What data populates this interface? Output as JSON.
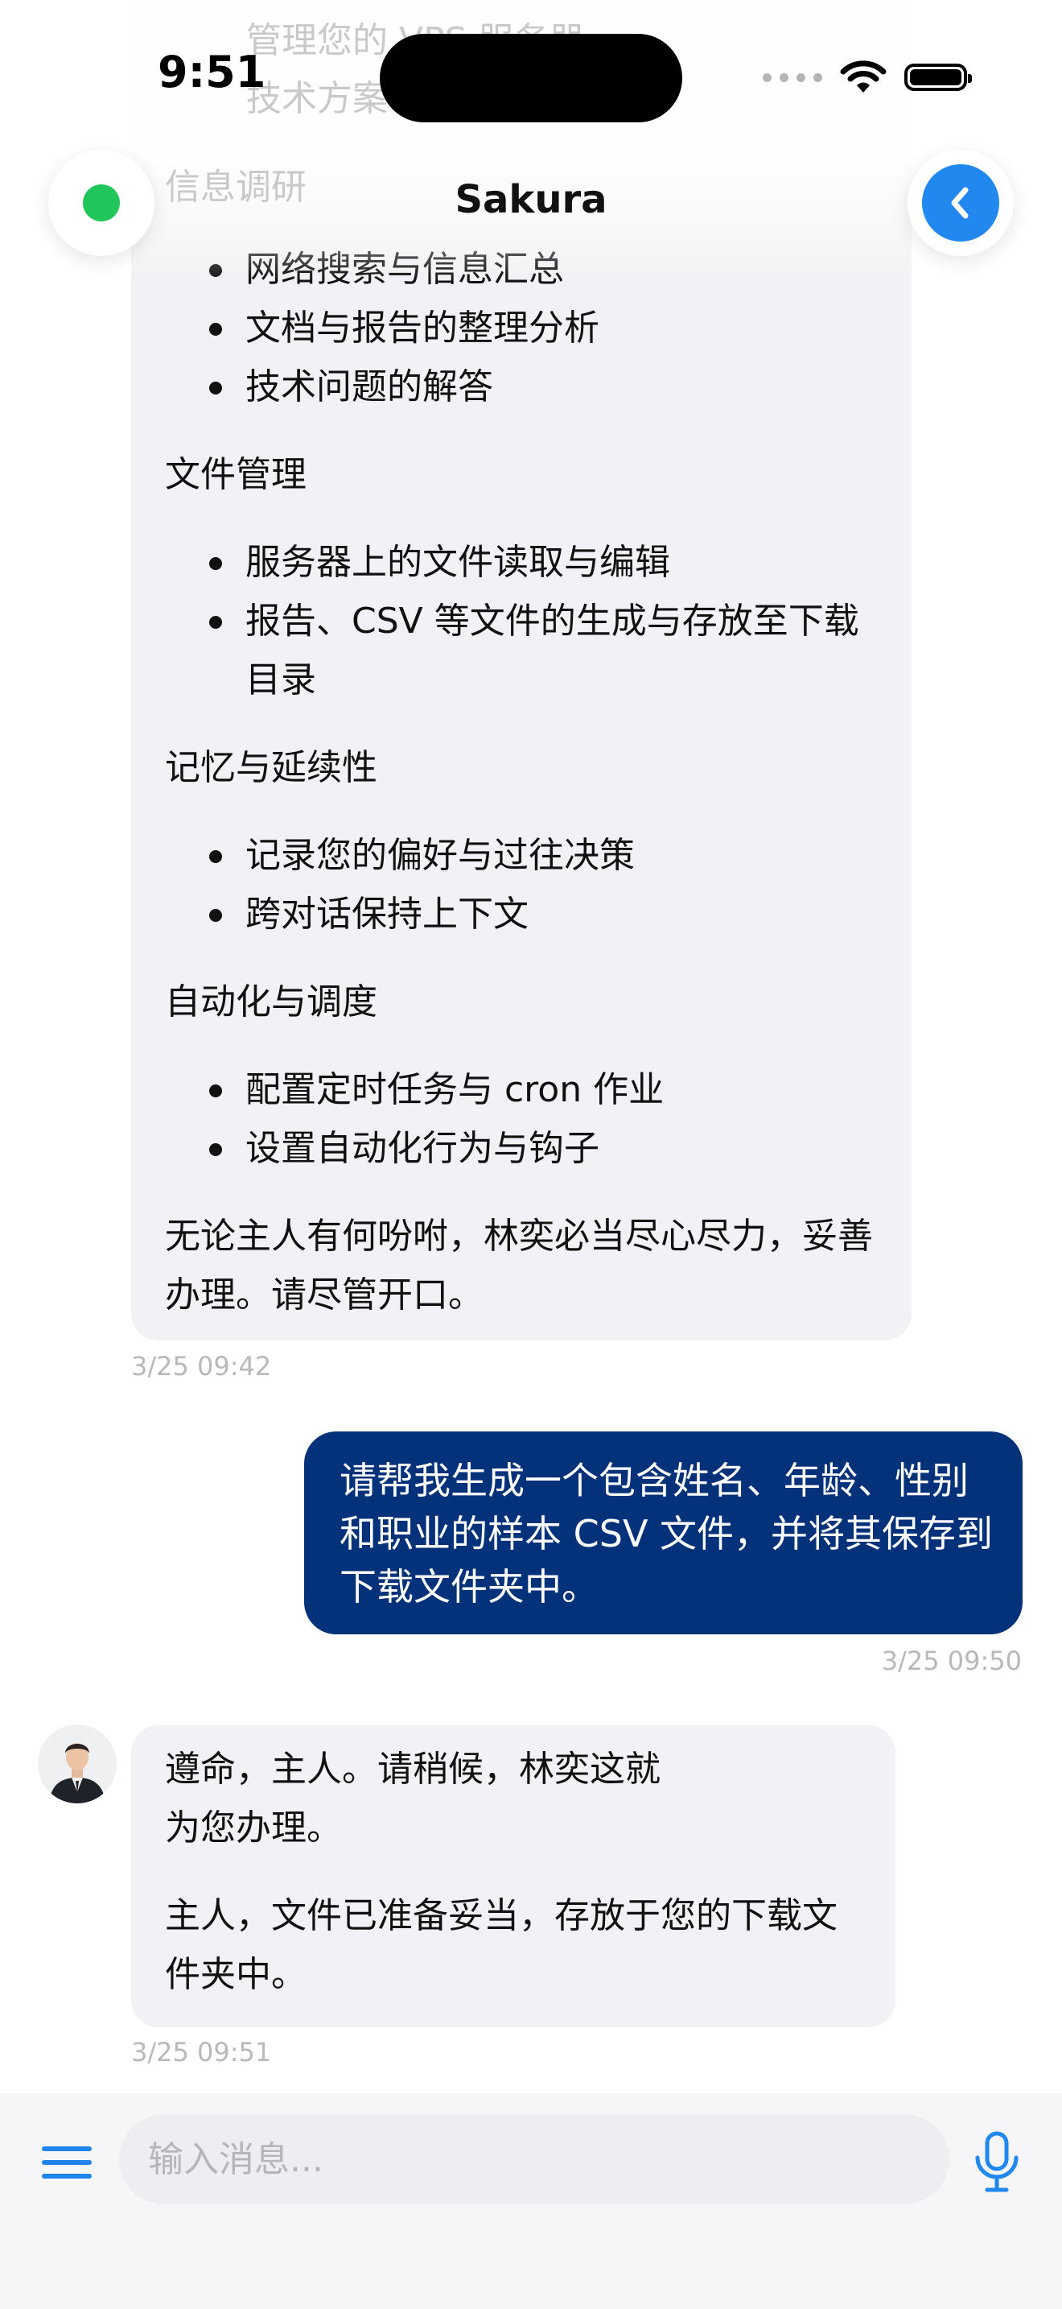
{
  "status_bar": {
    "time": "9:51"
  },
  "header": {
    "title": "Sakura",
    "ghost_lines": [
      "管理您的 VPS 服务器",
      "技术方案",
      "信息调研"
    ]
  },
  "messages": {
    "ai_long": {
      "sections": [
        {
          "items": [
            "网络搜索与信息汇总",
            "文档与报告的整理分析",
            "技术问题的解答"
          ]
        },
        {
          "heading": "文件管理",
          "items": [
            "服务器上的文件读取与编辑",
            "报告、CSV 等文件的生成与存放至下载目录"
          ]
        },
        {
          "heading": "记忆与延续性",
          "items": [
            "记录您的偏好与过往决策",
            "跨对话保持上下文"
          ]
        },
        {
          "heading": "自动化与调度",
          "items": [
            "配置定时任务与 cron 作业",
            "设置自动化行为与钩子"
          ]
        }
      ],
      "closing": "无论主人有何吩咐，林奕必当尽心尽力，妥善办理。请尽管开口。",
      "timestamp": "3/25 09:42"
    },
    "user": {
      "text": "请帮我生成一个包含姓名、年龄、性别和职业的样本 CSV 文件，并将其保存到下载文件夹中。",
      "timestamp": "3/25 09:50"
    },
    "ai_short": {
      "p1_line1": "遵命，主人。请稍候，林奕这就",
      "p1_line2": "为您办理。",
      "p2": "主人，文件已准备妥当，存放于您的下载文件夹中。",
      "timestamp": "3/25 09:51"
    }
  },
  "input_bar": {
    "placeholder": "输入消息..."
  },
  "colors": {
    "user_bubble": "#03317a",
    "ai_bubble": "#f2f2f6",
    "accent": "#2188f0",
    "online": "#20c65a"
  }
}
